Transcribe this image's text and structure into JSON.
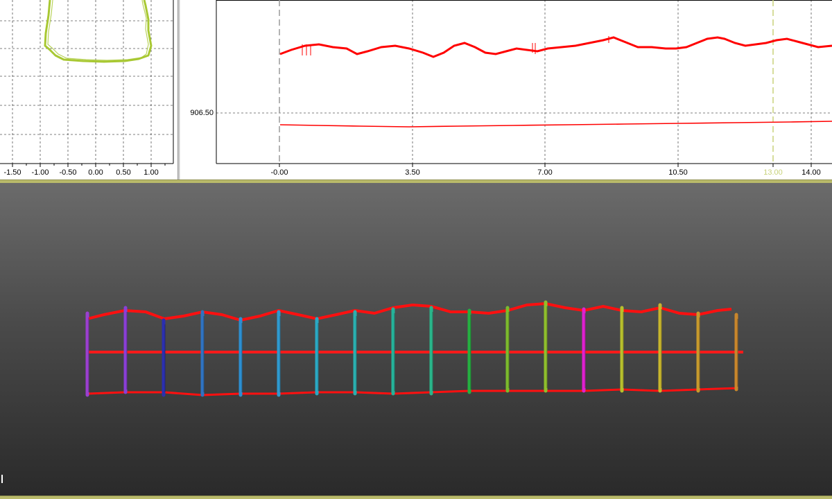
{
  "cross_section": {
    "x_ticks": [
      "-1.50",
      "-1.00",
      "-0.50",
      "0.00",
      "0.50",
      "1.00"
    ],
    "grid": true,
    "section_color": "#a8c832"
  },
  "profile": {
    "y_tick": "906.50",
    "x_ticks": [
      "-0.00",
      "3.50",
      "7.00",
      "10.50",
      "13.00",
      "14.00"
    ],
    "marker_value": "13.00",
    "marker_color": "#c8d27a",
    "series_color": "#ff0000",
    "grid": true
  },
  "viewport": {
    "section_colors": [
      "#9b3fd0",
      "#8a3fd6",
      "#2a2fb0",
      "#2f73c2",
      "#2c8fd1",
      "#2e9ad0",
      "#2aa9c4",
      "#2ab0b0",
      "#25b39a",
      "#2ab58a",
      "#25b040",
      "#7cbb2c",
      "#8fbf2c",
      "#e020d0",
      "#b8c02c",
      "#c8b62c",
      "#c89a2c",
      "#c8862c"
    ],
    "outline_color": "#ff1010",
    "centerline_color": "#ff1a1a"
  },
  "colors": {
    "separator": "#b9ba6a"
  }
}
